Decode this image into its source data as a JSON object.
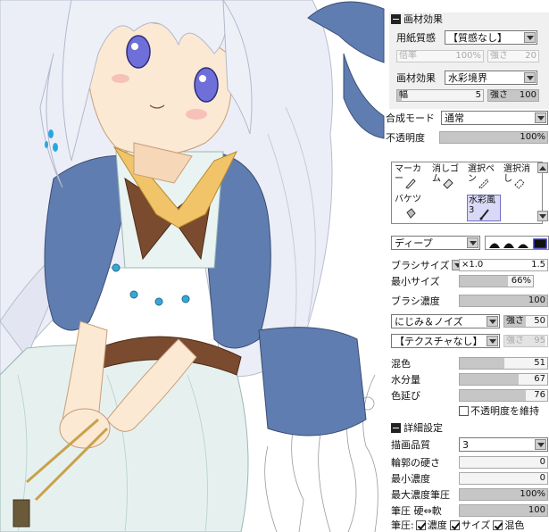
{
  "texture": {
    "header": "画材効果",
    "paper_label": "用紙質感",
    "paper_value": "【質感なし】",
    "rate_label": "倍率",
    "rate_value": "100%",
    "paper_strength_label": "強さ",
    "paper_strength_value": "20",
    "effect_label": "画材効果",
    "effect_value": "水彩境界",
    "width_label": "幅",
    "width_value": "5",
    "effect_strength_label": "強さ",
    "effect_strength_value": "100"
  },
  "blend": {
    "mode_label": "合成モード",
    "mode_value": "通常",
    "opacity_label": "不透明度",
    "opacity_value": "100%",
    "opacity_fraction": 1.0
  },
  "tools": {
    "items": [
      {
        "label": "マーカー",
        "icon": "marker-icon",
        "selected": false
      },
      {
        "label": "消しゴム",
        "icon": "eraser-icon",
        "selected": false
      },
      {
        "label": "選択ペン",
        "icon": "selection-pen-icon",
        "selected": false
      },
      {
        "label": "選択消し",
        "icon": "selection-eraser-icon",
        "selected": false
      },
      {
        "label": "バケツ",
        "icon": "bucket-icon",
        "selected": false
      },
      {
        "label": "水彩風3",
        "icon": "brush-icon",
        "selected": true
      }
    ]
  },
  "brush": {
    "shape_value": "ディープ",
    "size_label": "ブラシサイズ",
    "size_multiplier": "×1.0",
    "size_value": "1.5",
    "min_size_label": "最小サイズ",
    "min_size_value": "66%",
    "min_size_fraction": 0.66,
    "density_label": "ブラシ濃度",
    "density_value": "100",
    "density_fraction": 1.0,
    "noise_value": "にじみ＆ノイズ",
    "noise_strength_label": "強さ",
    "noise_strength_value": "50",
    "noise_strength_fraction": 0.5,
    "texture_value": "【テクスチャなし】",
    "texture_strength_label": "強さ",
    "texture_strength_value": "95",
    "texture_strength_fraction": 0.95,
    "mix_label": "混色",
    "mix_value": "51",
    "mix_fraction": 0.51,
    "water_label": "水分量",
    "water_value": "67",
    "water_fraction": 0.67,
    "stretch_label": "色延び",
    "stretch_value": "76",
    "stretch_fraction": 0.76,
    "keep_opacity_label": "不透明度を維持",
    "keep_opacity_checked": false
  },
  "advanced": {
    "header": "詳細設定",
    "quality_label": "描画品質",
    "quality_value": "3",
    "hardness_label": "輪郭の硬さ",
    "hardness_value": "0",
    "hardness_fraction": 0.0,
    "min_density_label": "最小濃度",
    "min_density_value": "0",
    "min_density_fraction": 0.0,
    "max_pressure_label": "最大濃度筆圧",
    "max_pressure_value": "100%",
    "max_pressure_fraction": 1.0,
    "pressure_label": "筆圧 硬⇔軟",
    "pressure_value": "100",
    "pressure_fraction": 1.0,
    "pen_pressure_label": "筆圧:",
    "pp_density_label": "濃度",
    "pp_size_label": "サイズ",
    "pp_mix_label": "混色",
    "pp_density_checked": true,
    "pp_size_checked": true,
    "pp_mix_checked": true
  },
  "colors": {
    "hair": "#e8eaf4",
    "eyes": "#6e6fd8",
    "cape": "#5f7db0",
    "dress": "#e6f1ef",
    "vest": "#7a4b2e",
    "collar": "#f2c46a",
    "skin": "#fbe9d4",
    "selected_tool": "#d9d9f7"
  }
}
